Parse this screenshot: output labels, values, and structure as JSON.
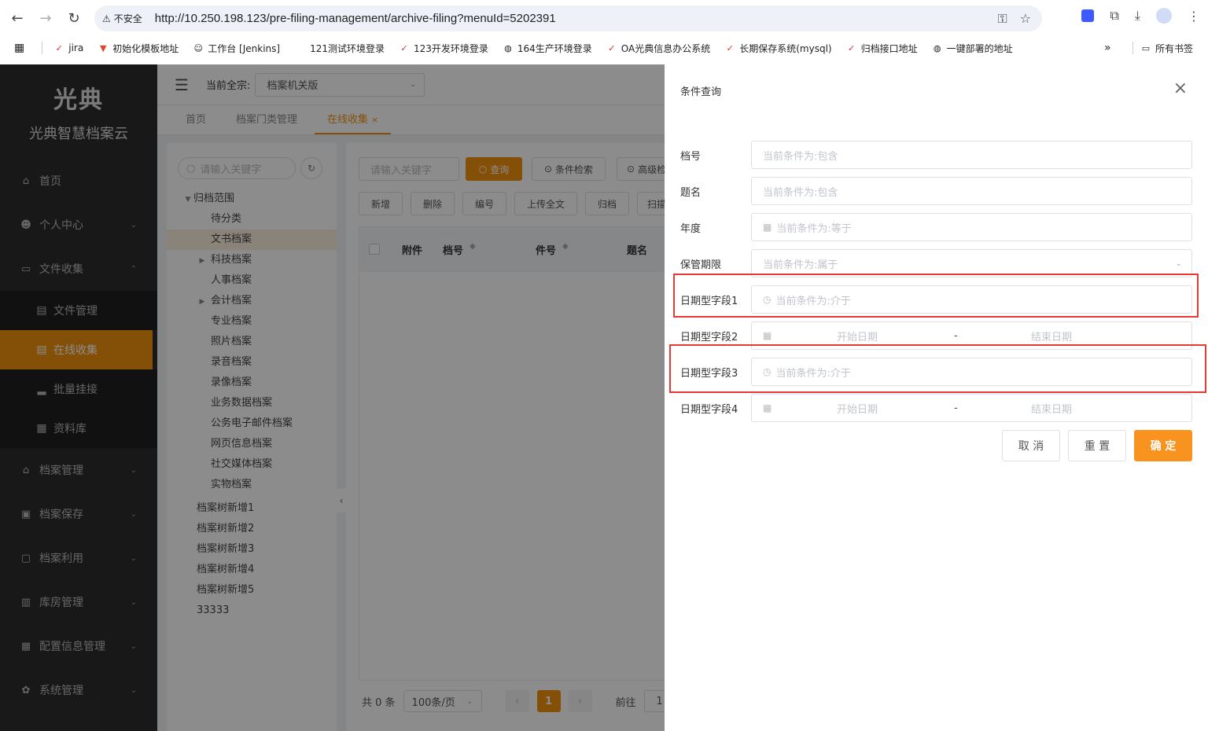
{
  "browser": {
    "insecure_label": "不安全",
    "url": "http://10.250.198.123/pre-filing-management/archive-filing?menuId=5202391",
    "bookmarks": [
      {
        "label": "jira"
      },
      {
        "label": "初始化模板地址"
      },
      {
        "label": "工作台 [Jenkins]"
      },
      {
        "label": "121测试环境登录"
      },
      {
        "label": "123开发环境登录"
      },
      {
        "label": "164生产环境登录"
      },
      {
        "label": "OA光典信息办公系统"
      },
      {
        "label": "长期保存系统(mysql)"
      },
      {
        "label": "归档接口地址"
      },
      {
        "label": "一键部署的地址"
      }
    ],
    "more": "»",
    "all_bookmarks": "所有书签"
  },
  "sidebar": {
    "logo_text": "光典",
    "brand": "光典智慧档案云",
    "items": [
      {
        "label": "首页"
      },
      {
        "label": "个人中心"
      },
      {
        "label": "文件收集"
      },
      {
        "label": "档案管理"
      },
      {
        "label": "档案保存"
      },
      {
        "label": "档案利用"
      },
      {
        "label": "库房管理"
      },
      {
        "label": "配置信息管理"
      },
      {
        "label": "系统管理"
      }
    ],
    "subitems": [
      {
        "label": "文件管理"
      },
      {
        "label": "在线收集"
      },
      {
        "label": "批量挂接"
      },
      {
        "label": "资料库"
      }
    ]
  },
  "topbar": {
    "fonds_label": "当前全宗:",
    "fonds_value": "档案机关版"
  },
  "tabs": [
    {
      "label": "首页"
    },
    {
      "label": "档案门类管理"
    },
    {
      "label": "在线收集"
    }
  ],
  "tree": {
    "search_placeholder": "请输入关键字",
    "root": "归档范围",
    "children": [
      "待分类",
      "文书档案",
      "科技档案",
      "人事档案",
      "会计档案",
      "专业档案",
      "照片档案",
      "录音档案",
      "录像档案",
      "业务数据档案",
      "公务电子邮件档案",
      "网页信息档案",
      "社交媒体档案",
      "实物档案"
    ],
    "others": [
      "档案树新增1",
      "档案树新增2",
      "档案树新增3",
      "档案树新增4",
      "档案树新增5",
      "33333"
    ]
  },
  "toolbar": {
    "keyword_placeholder": "请输入关键字",
    "query": "查询",
    "cond_search": "条件检索",
    "advanced": "高级检",
    "add": "新增",
    "delete": "删除",
    "number": "编号",
    "upload": "上传全文",
    "archive": "归档",
    "scan": "扫描"
  },
  "table": {
    "columns": [
      "附件",
      "档号",
      "件号",
      "题名"
    ]
  },
  "pager": {
    "total": "共 0 条",
    "page_size": "100条/页",
    "current": "1",
    "goto_label": "前往",
    "goto_value": "1"
  },
  "drawer": {
    "title": "条件查询",
    "fields": [
      {
        "label": "档号",
        "placeholder": "当前条件为:包含"
      },
      {
        "label": "题名",
        "placeholder": "当前条件为:包含"
      },
      {
        "label": "年度",
        "placeholder": "当前条件为:等于"
      },
      {
        "label": "保管期限",
        "placeholder": "当前条件为:属于"
      },
      {
        "label": "日期型字段1",
        "placeholder": "当前条件为:介于"
      },
      {
        "label": "日期型字段2",
        "start": "开始日期",
        "sep": "-",
        "end": "结束日期"
      },
      {
        "label": "日期型字段3",
        "placeholder": "当前条件为:介于"
      },
      {
        "label": "日期型字段4",
        "start": "开始日期",
        "sep": "-",
        "end": "结束日期"
      }
    ],
    "cancel": "取 消",
    "reset": "重 置",
    "confirm": "确 定"
  },
  "colors": {
    "accent": "#f0920e",
    "highlight": "#e53935",
    "sidebar": "#2d2d2d"
  }
}
